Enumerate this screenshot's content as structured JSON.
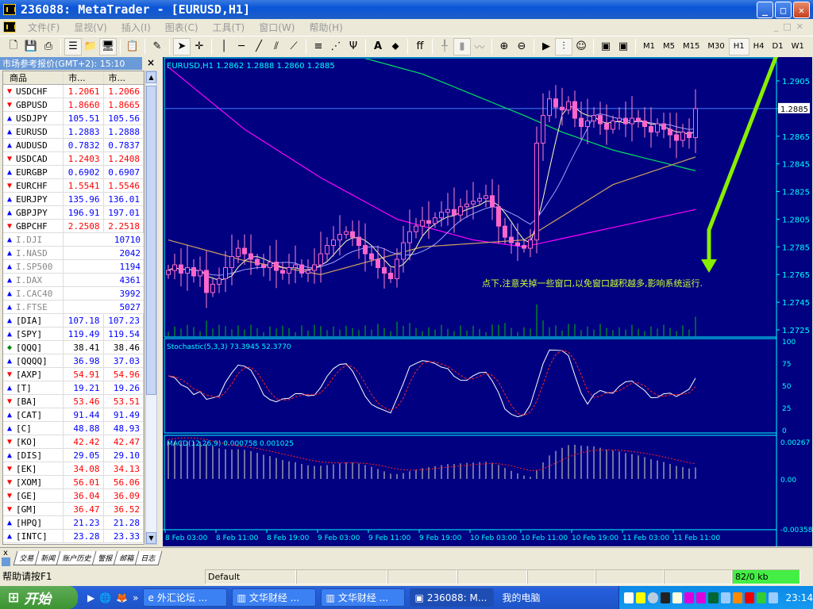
{
  "window": {
    "title": "236088: MetaTrader - [EURUSD,H1]"
  },
  "menu": [
    "文件(F)",
    "显视(V)",
    "插入(I)",
    "图表(C)",
    "工具(T)",
    "窗口(W)",
    "帮助(H)"
  ],
  "timeframes": [
    "M1",
    "M5",
    "M15",
    "M30",
    "H1",
    "H4",
    "D1",
    "W1"
  ],
  "active_timeframe": "H1",
  "market_watch": {
    "title": "市场参考报价(GMT+2): 15:10",
    "close": "×",
    "headers": [
      "商品",
      "市...",
      "市..."
    ],
    "rows": [
      {
        "s": "USDCHF",
        "bid": "1.2061",
        "ask": "1.2066",
        "dir": "down"
      },
      {
        "s": "GBPUSD",
        "bid": "1.8660",
        "ask": "1.8665",
        "dir": "down"
      },
      {
        "s": "USDJPY",
        "bid": "105.51",
        "ask": "105.56",
        "dir": "up"
      },
      {
        "s": "EURUSD",
        "bid": "1.2883",
        "ask": "1.2888",
        "dir": "up"
      },
      {
        "s": "AUDUSD",
        "bid": "0.7832",
        "ask": "0.7837",
        "dir": "up"
      },
      {
        "s": "USDCAD",
        "bid": "1.2403",
        "ask": "1.2408",
        "dir": "down"
      },
      {
        "s": "EURGBP",
        "bid": "0.6902",
        "ask": "0.6907",
        "dir": "up"
      },
      {
        "s": "EURCHF",
        "bid": "1.5541",
        "ask": "1.5546",
        "dir": "down"
      },
      {
        "s": "EURJPY",
        "bid": "135.96",
        "ask": "136.01",
        "dir": "up"
      },
      {
        "s": "GBPJPY",
        "bid": "196.91",
        "ask": "197.01",
        "dir": "up"
      },
      {
        "s": "GBPCHF",
        "bid": "2.2508",
        "ask": "2.2518",
        "dir": "down"
      },
      {
        "s": "I.DJI",
        "val": "10710",
        "dir": "up"
      },
      {
        "s": "I.NASD",
        "val": "2042",
        "dir": "up"
      },
      {
        "s": "I.SP500",
        "val": "1194",
        "dir": "up"
      },
      {
        "s": "I.DAX",
        "val": "4361",
        "dir": "up"
      },
      {
        "s": "I.CAC40",
        "val": "3992",
        "dir": "up"
      },
      {
        "s": "I.FTSE",
        "val": "5027",
        "dir": "up"
      },
      {
        "s": "[DIA]",
        "bid": "107.18",
        "ask": "107.23",
        "dir": "up"
      },
      {
        "s": "[SPY]",
        "bid": "119.49",
        "ask": "119.54",
        "dir": "up"
      },
      {
        "s": "[QQQ]",
        "bid": "38.41",
        "ask": "38.46",
        "dir": "flat"
      },
      {
        "s": "[QQQQ]",
        "bid": "36.98",
        "ask": "37.03",
        "dir": "up"
      },
      {
        "s": "[AXP]",
        "bid": "54.91",
        "ask": "54.96",
        "dir": "down"
      },
      {
        "s": "[T]",
        "bid": "19.21",
        "ask": "19.26",
        "dir": "up"
      },
      {
        "s": "[BA]",
        "bid": "53.46",
        "ask": "53.51",
        "dir": "down"
      },
      {
        "s": "[CAT]",
        "bid": "91.44",
        "ask": "91.49",
        "dir": "up"
      },
      {
        "s": "[C]",
        "bid": "48.88",
        "ask": "48.93",
        "dir": "up"
      },
      {
        "s": "[KO]",
        "bid": "42.42",
        "ask": "42.47",
        "dir": "down"
      },
      {
        "s": "[DIS]",
        "bid": "29.05",
        "ask": "29.10",
        "dir": "up"
      },
      {
        "s": "[EK]",
        "bid": "34.08",
        "ask": "34.13",
        "dir": "down"
      },
      {
        "s": "[XOM]",
        "bid": "56.01",
        "ask": "56.06",
        "dir": "down"
      },
      {
        "s": "[GE]",
        "bid": "36.04",
        "ask": "36.09",
        "dir": "down"
      },
      {
        "s": "[GM]",
        "bid": "36.47",
        "ask": "36.52",
        "dir": "down"
      },
      {
        "s": "[HPQ]",
        "bid": "21.23",
        "ask": "21.28",
        "dir": "up"
      },
      {
        "s": "[INTC]",
        "bid": "23.28",
        "ask": "23.33",
        "dir": "up"
      }
    ]
  },
  "colors": {
    "up": "#0000ff",
    "down": "#ff0000",
    "flat": "#000000",
    "chart_bg": "#000080",
    "axis": "#00ffff"
  },
  "chart_data": {
    "type": "line",
    "title": "EURUSD,H1  1.2862 1.2888 1.2860 1.2885",
    "current_price": "1.2885",
    "price_ticks": [
      "1.2905",
      "1.2885",
      "1.2865",
      "1.2845",
      "1.2825",
      "1.2805",
      "1.2785",
      "1.2765",
      "1.2745",
      "1.2725"
    ],
    "ylim": [
      1.2717,
      1.292
    ],
    "time_labels": [
      "8 Feb 03:00",
      "8 Feb 11:00",
      "8 Feb 19:00",
      "9 Feb 03:00",
      "9 Feb 11:00",
      "9 Feb 19:00",
      "10 Feb 03:00",
      "10 Feb 11:00",
      "10 Feb 19:00",
      "11 Feb 03:00",
      "11 Feb 11:00"
    ],
    "closes": [
      1.2768,
      1.2772,
      1.2766,
      1.277,
      1.2764,
      1.2768,
      1.2752,
      1.2758,
      1.2762,
      1.277,
      1.2778,
      1.2784,
      1.278,
      1.2776,
      1.2772,
      1.277,
      1.2774,
      1.2768,
      1.2766,
      1.277,
      1.2772,
      1.2766,
      1.2768,
      1.2772,
      1.278,
      1.2786,
      1.279,
      1.2794,
      1.2796,
      1.2792,
      1.2786,
      1.278,
      1.2776,
      1.277,
      1.2766,
      1.2762,
      1.2776,
      1.2788,
      1.2796,
      1.28,
      1.2804,
      1.2802,
      1.2806,
      1.281,
      1.2812,
      1.2808,
      1.2814,
      1.2816,
      1.2818,
      1.282,
      1.2822,
      1.2814,
      1.28,
      1.2792,
      1.2788,
      1.2786,
      1.2784,
      1.279,
      1.286,
      1.288,
      1.2892,
      1.2886,
      1.2884,
      1.289,
      1.2878,
      1.2872,
      1.2876,
      1.288,
      1.2874,
      1.287,
      1.2876,
      1.2878,
      1.2874,
      1.2878,
      1.2876,
      1.2872,
      1.2868,
      1.2874,
      1.287,
      1.2866,
      1.2862,
      1.2868,
      1.2864,
      1.2885
    ],
    "ma_lines": [
      {
        "name": "green-ma",
        "color": "#00e060",
        "bars": [
          0,
          28,
          40,
          56,
          62,
          70,
          83
        ],
        "values": [
          1.299,
          1.2925,
          1.291,
          1.288,
          1.2868,
          1.2855,
          1.284
        ]
      },
      {
        "name": "magenta-ma",
        "color": "#ff00ff",
        "bars": [
          0,
          12,
          24,
          36,
          48,
          56,
          66,
          83
        ],
        "values": [
          1.2915,
          1.287,
          1.2835,
          1.2805,
          1.279,
          1.2785,
          1.2795,
          1.2812
        ]
      },
      {
        "name": "tan-ma",
        "color": "#d0a060",
        "bars": [
          0,
          12,
          24,
          40,
          56,
          70,
          83
        ],
        "values": [
          1.279,
          1.2775,
          1.2765,
          1.2785,
          1.279,
          1.283,
          1.285
        ]
      }
    ],
    "annotation": "点下,注意关掉一些窗口,以免窗口越积越多,影响系统运行.",
    "stochastic": {
      "title": "Stochastic(5,3,3)  73.3945  52.3770",
      "ticks": [
        "100",
        "75",
        "50",
        "25",
        "0"
      ]
    },
    "macd": {
      "title": "MACD(12,26,9)  0.000758  0.001025",
      "ticks": [
        "0.00267",
        "0.00",
        "-0.00358"
      ],
      "ylim": [
        -0.00358,
        0.00267
      ]
    }
  },
  "bottom_tabs": [
    "交易",
    "新闻",
    "账户历史",
    "警报",
    "邮箱",
    "日志"
  ],
  "status": {
    "help": "帮助请按F1",
    "profile": "Default",
    "traffic": "82/0 kb"
  },
  "taskbar": {
    "start": "开始",
    "tasks": [
      "外汇论坛 ...",
      "文华财经 ...",
      "文华财经 ...",
      "236088: M..."
    ],
    "desktop": "我的电脑",
    "clock": "23:14"
  }
}
